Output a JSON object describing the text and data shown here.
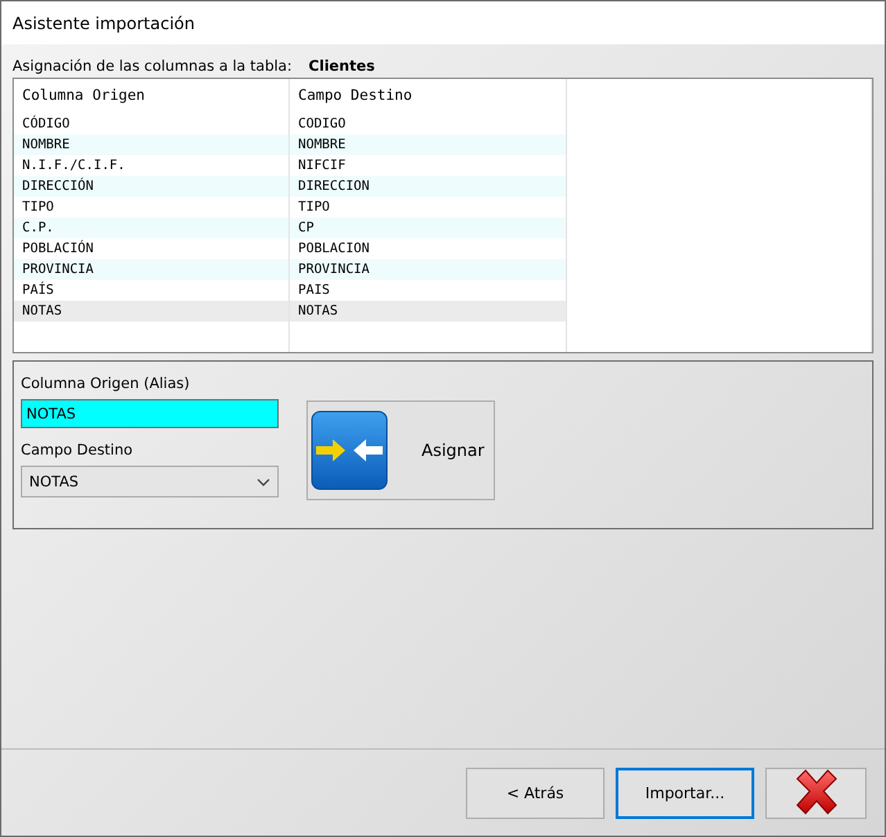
{
  "window": {
    "title": "Asistente importación"
  },
  "mapping": {
    "label": "Asignación de las columnas a la tabla:",
    "table_name": "Clientes"
  },
  "table": {
    "columns": [
      "Columna Origen",
      "Campo Destino"
    ],
    "rows": [
      {
        "source": "CÓDIGO",
        "target": "CODIGO",
        "selected": false
      },
      {
        "source": "NOMBRE",
        "target": "NOMBRE",
        "selected": false
      },
      {
        "source": "N.I.F./C.I.F.",
        "target": "NIFCIF",
        "selected": false
      },
      {
        "source": "DIRECCIÓN",
        "target": "DIRECCION",
        "selected": false
      },
      {
        "source": "TIPO",
        "target": "TIPO",
        "selected": false
      },
      {
        "source": "C.P.",
        "target": "CP",
        "selected": false
      },
      {
        "source": "POBLACIÓN",
        "target": "POBLACION",
        "selected": false
      },
      {
        "source": "PROVINCIA",
        "target": "PROVINCIA",
        "selected": false
      },
      {
        "source": "PAÍS",
        "target": "PAIS",
        "selected": false
      },
      {
        "source": "NOTAS",
        "target": "NOTAS",
        "selected": true
      }
    ]
  },
  "editor": {
    "alias_label": "Columna Origen (Alias)",
    "alias_value": "NOTAS",
    "target_label": "Campo Destino",
    "target_value": "NOTAS",
    "assign_button": "Asignar"
  },
  "buttons": [
    {
      "label": "< Atrás",
      "kind": "text",
      "focused": false
    },
    {
      "label": "Importar...",
      "kind": "text",
      "focused": true
    },
    {
      "kind": "cancel",
      "focused": false
    }
  ]
}
